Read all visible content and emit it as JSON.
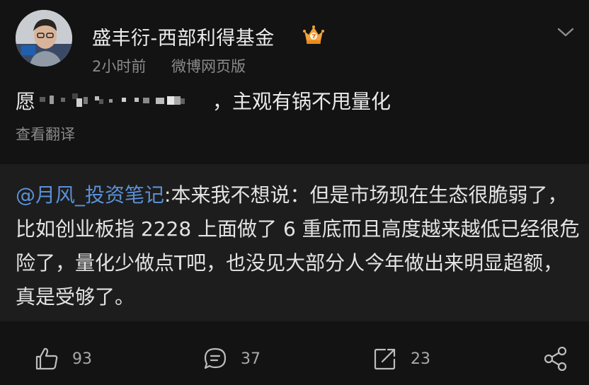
{
  "author": {
    "name": "盛丰衍-西部利得基金",
    "avatar_alt": "avatar",
    "badge_icon": "crown-icon"
  },
  "meta": {
    "time": "2小时前",
    "source": "微博网页版"
  },
  "post": {
    "text_prefix": "愿",
    "text_suffix": "，主观有锅不甩量化",
    "translate_label": "查看翻译"
  },
  "repost": {
    "mention": "@月风_投资笔记",
    "text": ":本来我不想说：但是市场现在生态很脆弱了，比如创业板指 2228 上面做了 6 重底而且高度越来越低已经很危险了，量化少做点T吧，也没见大部分人今年做出来明显超额，真是受够了。"
  },
  "actions": {
    "like_count": "93",
    "comment_count": "37",
    "repost_count": "23"
  },
  "colors": {
    "background": "#131313",
    "repost_background": "#1d1d1d",
    "mention": "#5b90d6",
    "muted_text": "#8b8b8b"
  }
}
